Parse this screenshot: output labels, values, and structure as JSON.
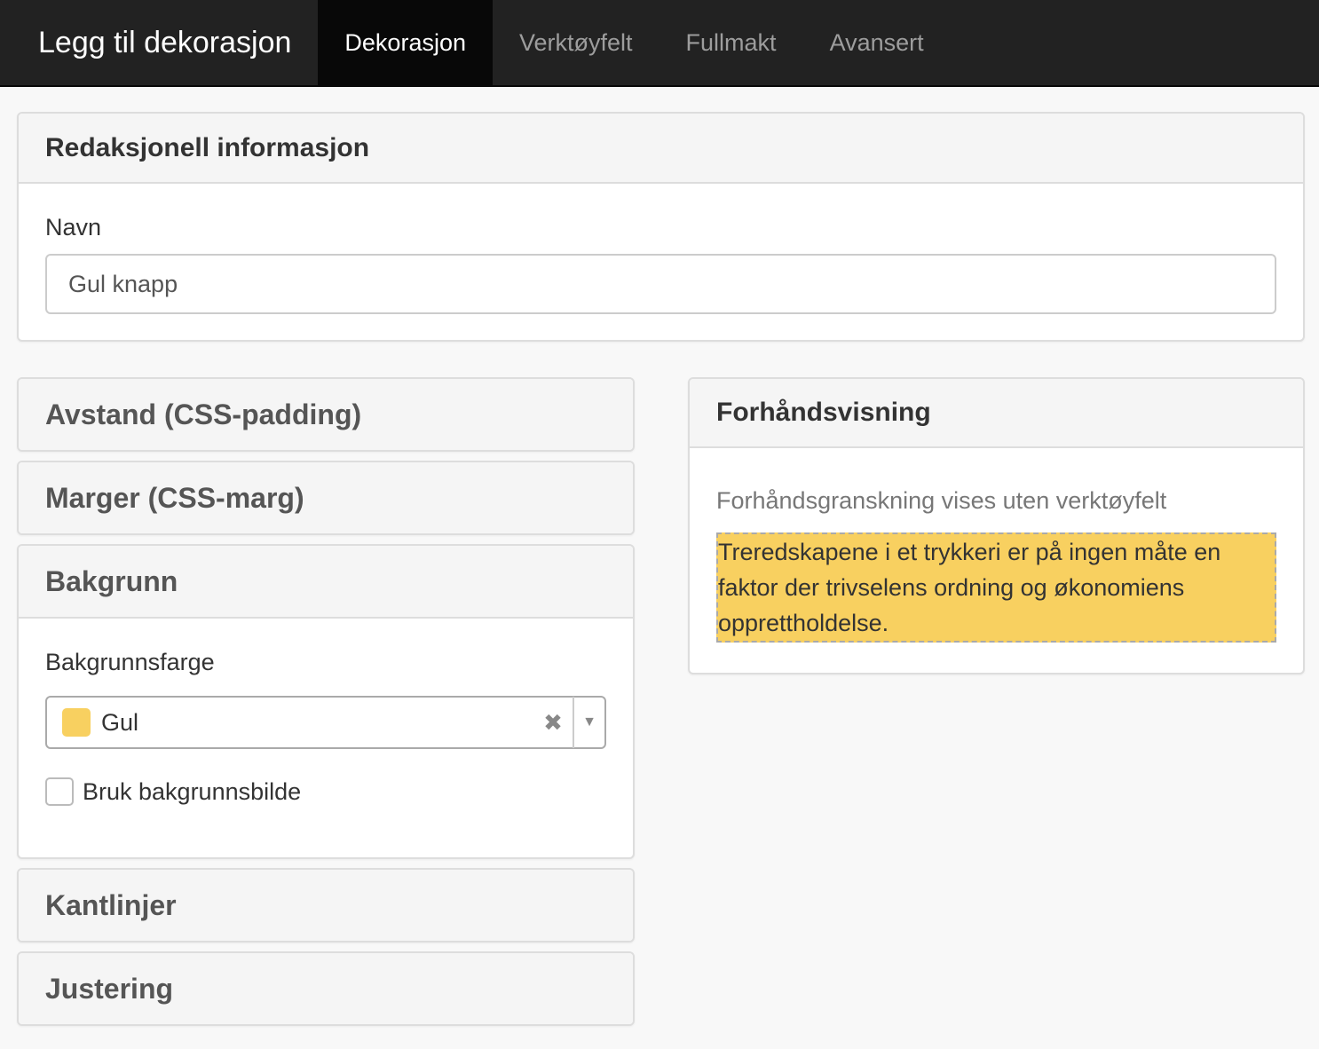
{
  "navbar": {
    "brand": "Legg til dekorasjon",
    "tabs": [
      {
        "label": "Dekorasjon",
        "active": true
      },
      {
        "label": "Verktøyfelt",
        "active": false
      },
      {
        "label": "Fullmakt",
        "active": false
      },
      {
        "label": "Avansert",
        "active": false
      }
    ]
  },
  "editorial": {
    "heading": "Redaksjonell informasjon",
    "name_label": "Navn",
    "name_value": "Gul knapp"
  },
  "sections": {
    "padding": "Avstand (CSS-padding)",
    "margins": "Marger (CSS-marg)",
    "background": {
      "heading": "Bakgrunn",
      "color_label": "Bakgrunnsfarge",
      "color_value": "Gul",
      "color_hex": "#f8d060",
      "clear_glyph": "✖",
      "arrow_glyph": "▼",
      "use_image_label": "Bruk bakgrunnsbilde",
      "use_image_checked": false
    },
    "borders": "Kantlinjer",
    "alignment": "Justering"
  },
  "preview": {
    "heading": "Forhåndsvisning",
    "note": "Forhåndsgranskning vises uten verktøyfelt",
    "sample_text": "Treredskapene i et trykkeri er på ingen måte en faktor der trivselens ordning og økonomiens opprettholdelse."
  }
}
